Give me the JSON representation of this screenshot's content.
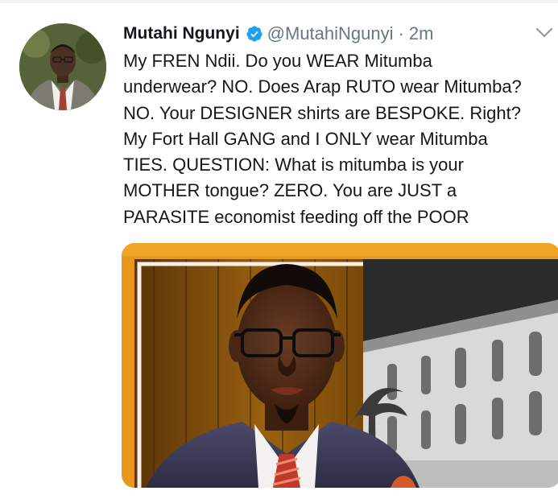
{
  "tweet": {
    "author": {
      "display_name": "Mutahi Ngunyi",
      "handle": "@MutahiNgunyi",
      "verified": true
    },
    "separator": "·",
    "timestamp": "2m",
    "text": "My FREN Ndii. Do you WEAR Mitumba\nunderwear? NO. Does Arap RUTO wear Mitumba?\nNO. Your DESIGNER shirts are BESPOKE. Right?\nMy Fort Hall GANG and I ONLY wear Mitumba\nTIES. QUESTION: What is mitumba is your\nMOTHER tongue? ZERO. You are JUST a\nPARASITE economist feeding off the POOR",
    "media": {
      "type": "photo",
      "subject": "man-in-suit-with-glasses-in-front-of-building"
    }
  },
  "icons": {
    "verified": "verified-badge-icon",
    "menu": "chevron-down-icon"
  },
  "colors": {
    "verified_blue": "#1da1f2",
    "text_primary": "#14171a",
    "text_secondary": "#657786",
    "frame_orange": "#e8961c"
  }
}
